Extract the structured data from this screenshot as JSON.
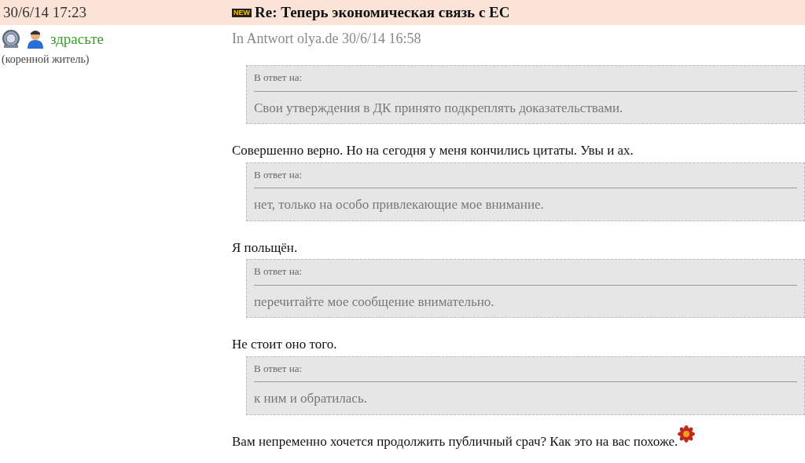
{
  "header": {
    "date": "30/6/14 17:23",
    "badge": "NEW",
    "title": "Re: Теперь экономическая связь с ЕС"
  },
  "author": {
    "name": "здрасьте",
    "rank": "(коренной житель)"
  },
  "reply_info": "In Antwort olya.de 30/6/14 16:58",
  "content": [
    {
      "kind": "quote",
      "label": "В ответ на:",
      "text": "Свои утверждения в ДК принято подкреплять доказательствами."
    },
    {
      "kind": "text",
      "text": "Совершенно верно. Но на сегодня у меня кончились цитаты. Увы и ах."
    },
    {
      "kind": "quote",
      "label": "В ответ на:",
      "text": "нет, только на особо привлекающие мое внимание."
    },
    {
      "kind": "text",
      "text": "Я польщён."
    },
    {
      "kind": "quote",
      "label": "В ответ на:",
      "text": "перечитайте мое сообщение внимательно."
    },
    {
      "kind": "text",
      "text": "Не стоит оно того."
    },
    {
      "kind": "quote",
      "label": "В ответ на:",
      "text": "к ним и обратилась."
    },
    {
      "kind": "text",
      "text": "Вам непременно хочется продолжить публичный срач? Как это на вас похоже.",
      "smiley": true
    }
  ]
}
